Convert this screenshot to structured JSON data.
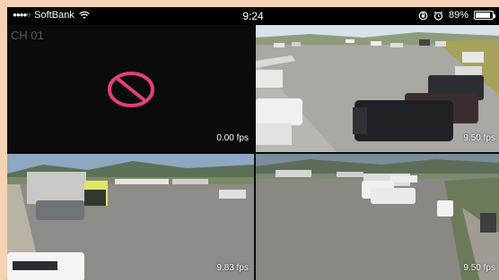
{
  "status_bar": {
    "signal_dots": "●●●●○",
    "carrier": "SoftBank",
    "time": "9:24",
    "battery_percent": "89%",
    "battery_level": 0.89
  },
  "cameras": [
    {
      "channel": "CH 01",
      "fps": "0.00 fps",
      "no_signal": true
    },
    {
      "channel": "",
      "fps": "9.50 fps"
    },
    {
      "channel": "",
      "fps": "9.83 fps"
    },
    {
      "channel": "",
      "fps": "9.50 fps"
    }
  ],
  "icons": {
    "wifi": "wifi-icon",
    "lock_rotation": "orientation-lock-icon",
    "alarm": "alarm-icon",
    "no_signal": "no-entry-icon"
  },
  "colors": {
    "no_signal": "#e0417a",
    "background": "#0b0b0b",
    "frame": "#f3d3b3"
  }
}
